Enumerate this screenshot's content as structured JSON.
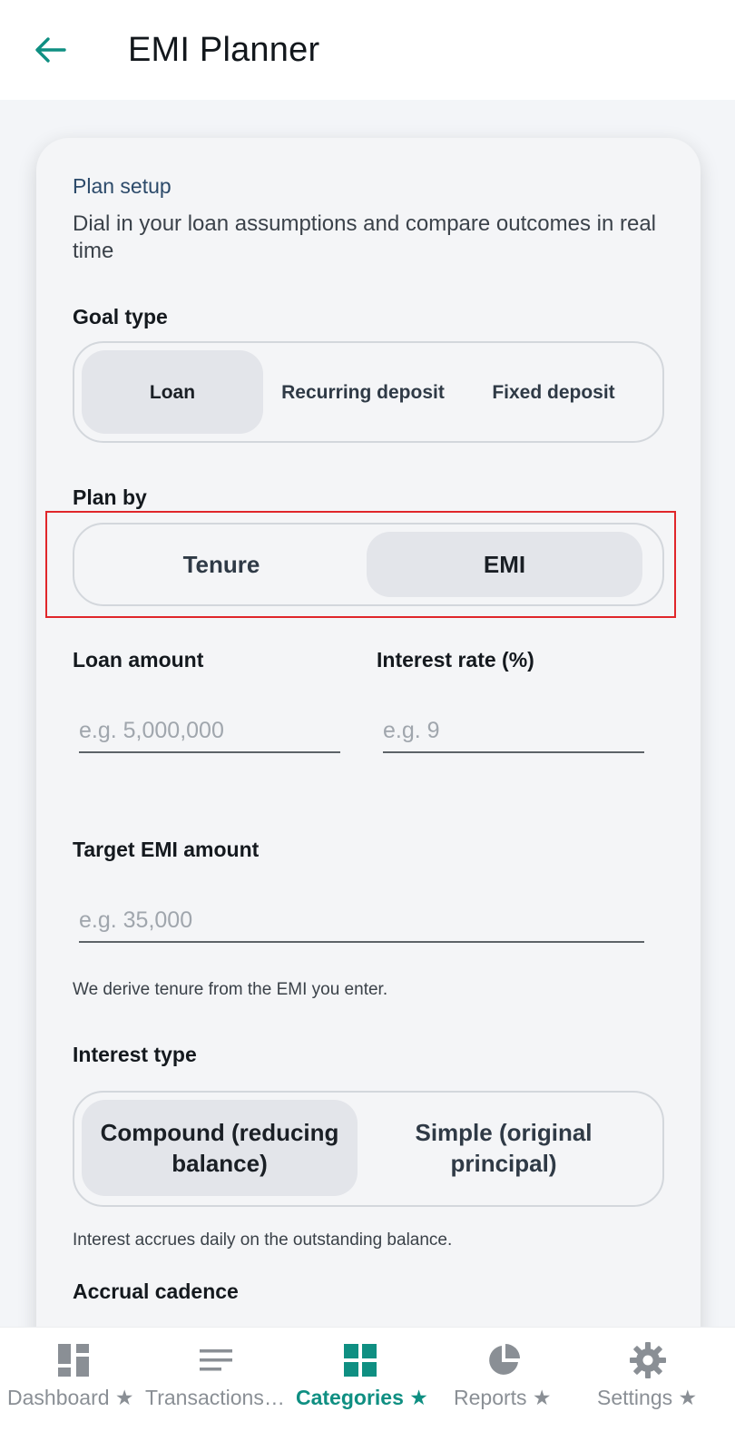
{
  "app_bar": {
    "title": "EMI Planner",
    "back_icon": "arrow-left-icon"
  },
  "plan_setup": {
    "section_label": "Plan setup",
    "description": "Dial in your loan assumptions and compare outcomes in real time"
  },
  "goal_type": {
    "label": "Goal type",
    "options": [
      "Loan",
      "Recurring deposit",
      "Fixed deposit"
    ],
    "selected": "Loan"
  },
  "plan_by": {
    "label": "Plan by",
    "options": [
      "Tenure",
      "EMI"
    ],
    "selected": "EMI"
  },
  "loan_amount": {
    "label": "Loan amount",
    "placeholder": "e.g. 5,000,000",
    "value": ""
  },
  "interest_rate": {
    "label": "Interest rate (%)",
    "placeholder": "e.g. 9",
    "value": ""
  },
  "target_emi": {
    "label": "Target EMI amount",
    "placeholder": "e.g. 35,000",
    "value": "",
    "help": "We derive tenure from the EMI you enter."
  },
  "interest_type": {
    "label": "Interest type",
    "options": [
      "Compound (reducing balance)",
      "Simple (original principal)"
    ],
    "selected": "Compound (reducing balance)",
    "help": "Interest accrues daily on the outstanding balance."
  },
  "accrual_cadence": {
    "label": "Accrual cadence"
  },
  "bottom_nav": {
    "items": [
      {
        "label": "Dashboard ★",
        "icon": "dashboard-icon"
      },
      {
        "label": "Transactions…",
        "icon": "list-icon"
      },
      {
        "label": "Categories ★",
        "icon": "grid-icon",
        "active": true
      },
      {
        "label": "Reports ★",
        "icon": "pie-chart-icon"
      },
      {
        "label": "Settings ★",
        "icon": "gear-icon"
      }
    ]
  },
  "colors": {
    "accent": "#0f8f82",
    "highlight": "#e0262a",
    "selected_segment": "#e3e5ea"
  }
}
